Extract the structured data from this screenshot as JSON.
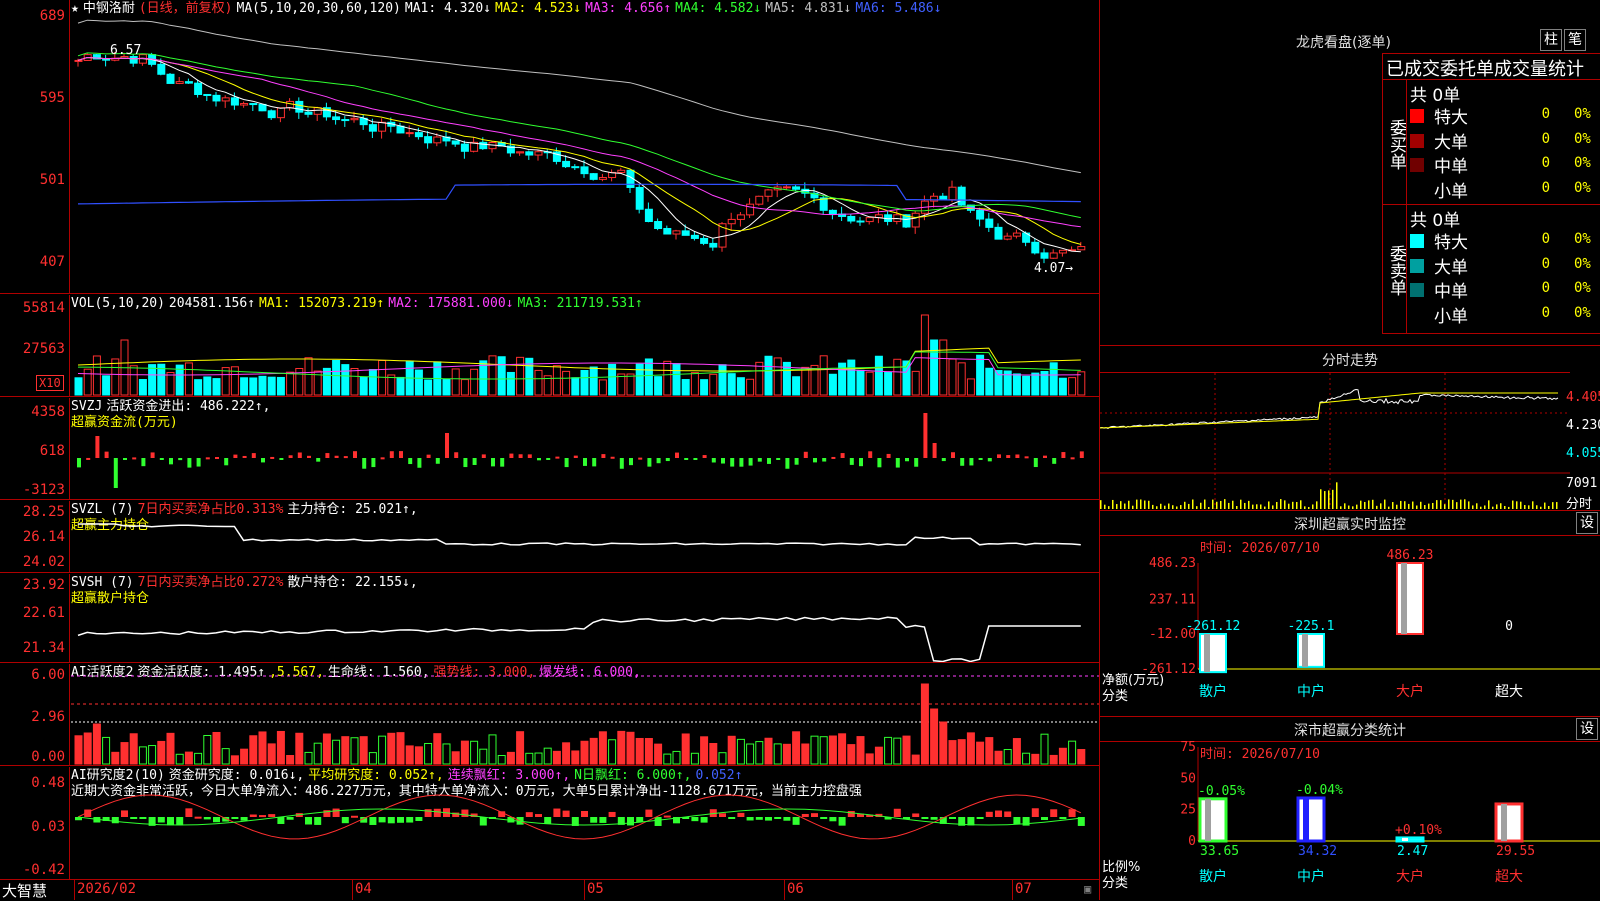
{
  "colors": {
    "up": "#ff3030",
    "down": "#00ffff",
    "grid": "#b00000"
  },
  "kline": {
    "header": {
      "name": "中钢洛耐",
      "period": "(日线，前复权)",
      "ma_label": "MA(5,10,20,30,60,120)",
      "ma1": "MA1: 4.320↓",
      "ma2": "MA2: 4.523↓",
      "ma3": "MA3: 4.656↑",
      "ma4": "MA4: 4.582↓",
      "ma5": "MA5: 4.831↓",
      "ma6": "MA6: 5.486↓"
    },
    "yticks": [
      "689",
      "595",
      "501",
      "407"
    ],
    "high_label": "6.57",
    "low_label": "4.07→"
  },
  "vol": {
    "label": "VOL(5,10,20)",
    "value": "204581.156↑",
    "ma1": "MA1: 152073.219↑",
    "ma2": "MA2: 175881.000↓",
    "ma3": "MA3: 211719.531↑",
    "yticks": [
      "55814",
      "27563"
    ],
    "unit": "X10"
  },
  "svzj": {
    "label": "SVZJ",
    "title": "活跃资金进出: 486.222↑,",
    "subtitle": "超赢资金流(万元)",
    "yticks": [
      "4358",
      "618",
      "-3123"
    ]
  },
  "svzl": {
    "label": "SVZL (7)",
    "ratio": "7日内买卖净占比0.313%",
    "hold": "主力持仓: 25.021↑,",
    "subtitle": "超赢主力持仓",
    "yticks": [
      "28.25",
      "26.14",
      "24.02"
    ]
  },
  "svsh": {
    "label": "SVSH (7)",
    "ratio": "7日内买卖净占比0.272%",
    "hold": "散户持仓: 22.155↓,",
    "subtitle": "超赢散户持仓",
    "yticks": [
      "23.92",
      "22.61",
      "21.34"
    ]
  },
  "ai1": {
    "label": "AI活跃度2",
    "act": "资金活跃度: 1.495↑",
    "v2": ",5.567,",
    "life": "生命线: 1.560,",
    "strong": "强势线: 3.000,",
    "burst": "爆发线: 6.000,",
    "yticks": [
      "6.00",
      "2.96",
      "0.00"
    ]
  },
  "ai2": {
    "label": "AI研究度2(10)",
    "res": "资金研究度: 0.016↓,",
    "avg": "平均研究度: 0.052↑,",
    "lian": "连续飘红: 3.000↑,",
    "nri": "N日飘红: 6.000↑,",
    "v5": "0.052↑",
    "note": "近期大资金非常活跃，今日大单净流入：486.227万元，其中特大单净流入：0万元，大单5日累计净出-1128.671万元，当前主力控盘强",
    "yticks": [
      "0.48",
      "0.03",
      "-0.42"
    ]
  },
  "timeaxis": {
    "start": "2026/02",
    "m4": "04",
    "m5": "05",
    "m6": "06",
    "m7": "07",
    "brand": "大智慧"
  },
  "dragon": {
    "title": "龙虎看盘(逐单)",
    "btn1": "柱",
    "btn2": "笔",
    "subtitle": "已成交委托单成交量统计",
    "buy": {
      "side": "委买单",
      "count": "共 0单",
      "rows": [
        {
          "name": "特大",
          "v": "0",
          "p": "0%",
          "color": "#ff0000"
        },
        {
          "name": "大单",
          "v": "0",
          "p": "0%",
          "color": "#a00000"
        },
        {
          "name": "中单",
          "v": "0",
          "p": "0%",
          "color": "#700000"
        },
        {
          "name": "小单",
          "v": "0",
          "p": "0%",
          "color": "#000000"
        }
      ]
    },
    "sell": {
      "side": "委卖单",
      "count": "共 0单",
      "rows": [
        {
          "name": "特大",
          "v": "0",
          "p": "0%",
          "color": "#00ffff"
        },
        {
          "name": "大单",
          "v": "0",
          "p": "0%",
          "color": "#00a0a0"
        },
        {
          "name": "中单",
          "v": "0",
          "p": "0%",
          "color": "#007070"
        },
        {
          "name": "小单",
          "v": "0",
          "p": "0%",
          "color": "#000000"
        }
      ]
    }
  },
  "intraday": {
    "title": "分时走势",
    "prices": [
      "4.405",
      "4.230",
      "4.055"
    ],
    "vol": "7091",
    "unit": "分时"
  },
  "sz_monitor": {
    "title": "深圳超赢实时监控",
    "btn": "设",
    "time": "时间: 2026/07/10",
    "yticks": [
      "486.23",
      "237.11",
      "-12.00",
      "-261.12"
    ],
    "ylabel": "净额(万元)",
    "xlabel": "分类",
    "chart_data": {
      "type": "bar",
      "categories": [
        "散户",
        "中户",
        "大户",
        "超大"
      ],
      "values": [
        -261.12,
        -225.1,
        486.23,
        0
      ],
      "labels": [
        "-261.12",
        "-225.1",
        "486.23",
        "0"
      ],
      "ylim": [
        -261.12,
        486.23
      ]
    }
  },
  "sz_class": {
    "title": "深市超赢分类统计",
    "btn": "设",
    "time": "时间: 2026/07/10",
    "yticks": [
      "75",
      "50",
      "25",
      "0"
    ],
    "ylabel": "比例%",
    "xlabel": "分类",
    "chart_data": {
      "type": "bar",
      "categories": [
        "散户",
        "中户",
        "大户",
        "超大"
      ],
      "values": [
        33.65,
        34.32,
        2.47,
        29.55
      ],
      "changes": [
        "-0.05%",
        "-0.04%",
        "+0.10%",
        ""
      ],
      "ylim": [
        0,
        75
      ]
    }
  }
}
